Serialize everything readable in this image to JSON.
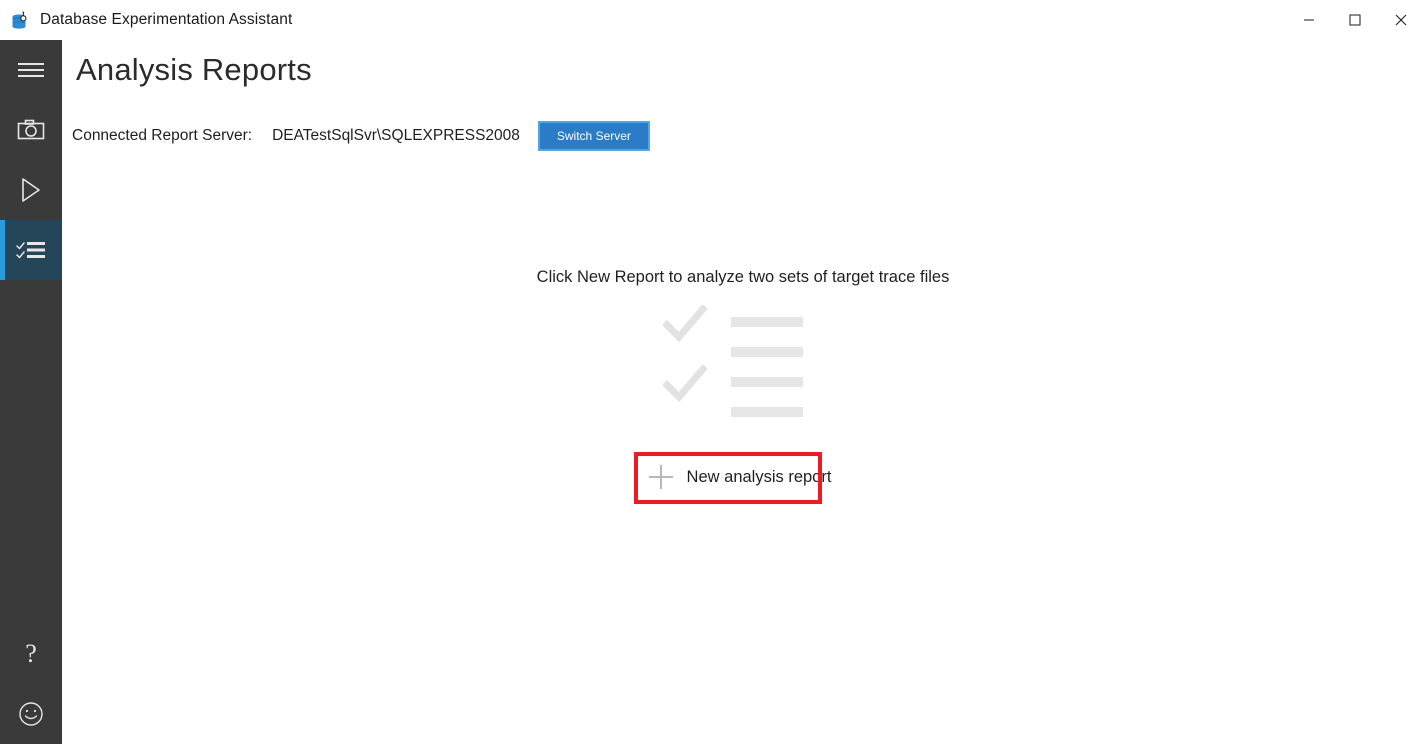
{
  "window": {
    "title": "Database Experimentation Assistant",
    "app_icon": "database-flask-icon",
    "controls": [
      {
        "name": "minimize",
        "icon": "minimize-icon",
        "glyph": "─"
      },
      {
        "name": "maximize",
        "icon": "maximize-icon",
        "glyph": "□"
      },
      {
        "name": "close",
        "icon": "close-icon",
        "glyph": "✕"
      }
    ]
  },
  "sidebar": {
    "background": "#3a3a3a",
    "active_background": "#254558",
    "accent": "#2b9ad9",
    "items": [
      {
        "name": "menu",
        "icon": "hamburger-menu-icon",
        "active": false
      },
      {
        "name": "capture",
        "icon": "camera-icon",
        "active": false
      },
      {
        "name": "replay",
        "icon": "play-icon",
        "active": false
      },
      {
        "name": "analysis-reports",
        "icon": "checklist-icon",
        "active": true
      }
    ],
    "bottom_items": [
      {
        "name": "help",
        "icon": "question-mark-icon",
        "glyph": "?"
      },
      {
        "name": "feedback",
        "icon": "smiley-face-icon"
      }
    ]
  },
  "page": {
    "title": "Analysis Reports",
    "server": {
      "label": "Connected Report Server:",
      "value": "DEATestSqlSvr\\SQLEXPRESS2008",
      "switch_button_label": "Switch Server",
      "switch_button_color": "#2a7cc7",
      "switch_button_border": "#55a5e2"
    },
    "empty_state": {
      "hint": "Click New Report to analyze two sets of target trace files",
      "illustration": "checklist-placeholder-art",
      "illustration_color": "#e6e6e6",
      "new_report_label": "New analysis report",
      "new_report_icon": "plus-icon"
    },
    "annotation": {
      "name": "red-highlight-box",
      "color": "#ec1c24",
      "target": "New analysis report"
    }
  }
}
